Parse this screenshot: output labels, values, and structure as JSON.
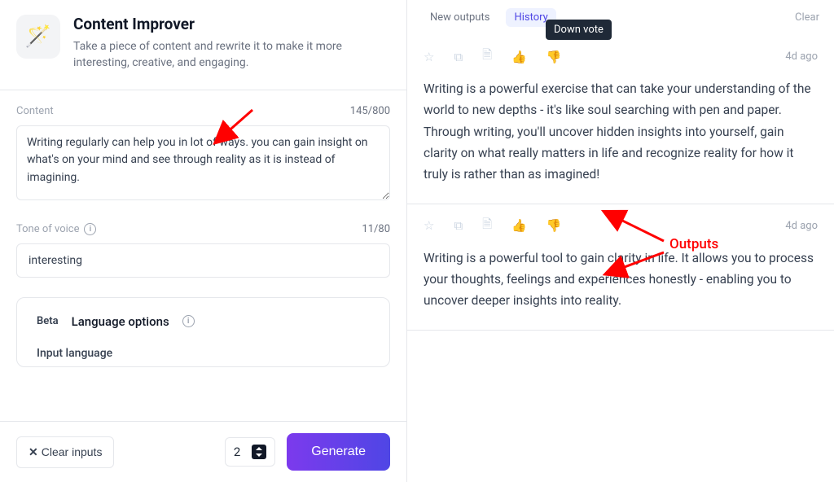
{
  "header": {
    "title": "Content Improver",
    "subtitle": "Take a piece of content and rewrite it to make it more interesting, creative, and engaging.",
    "icon": "🪄"
  },
  "content_field": {
    "label": "Content",
    "counter": "145/800",
    "value": "Writing regularly can help you in lot of ways. you can gain insight on what's on your mind and see through reality as it is instead of imagining."
  },
  "tone_field": {
    "label": "Tone of voice",
    "counter": "11/80",
    "value": "interesting"
  },
  "language_panel": {
    "beta": "Beta",
    "options_label": "Language options",
    "input_lang_label": "Input language"
  },
  "footer": {
    "clear": "Clear inputs",
    "count": "2",
    "generate": "Generate"
  },
  "tabs": {
    "new_outputs": "New outputs",
    "history": "History",
    "clear": "Clear",
    "tooltip": "Down vote"
  },
  "outputs": [
    {
      "ago": "4d ago",
      "text": "Writing is a powerful exercise that can take your understanding of the world to new depths - it's like soul searching with pen and paper. Through writing, you'll uncover hidden insights into yourself, gain clarity on what really matters in life and recognize reality for how it truly is rather than as imagined!"
    },
    {
      "ago": "4d ago",
      "text": "Writing is a powerful tool to gain clarity in life. It allows you to process your thoughts, feelings and experiences honestly - enabling you to uncover deeper insights into reality."
    }
  ],
  "annotation": {
    "label": "Outputs"
  }
}
